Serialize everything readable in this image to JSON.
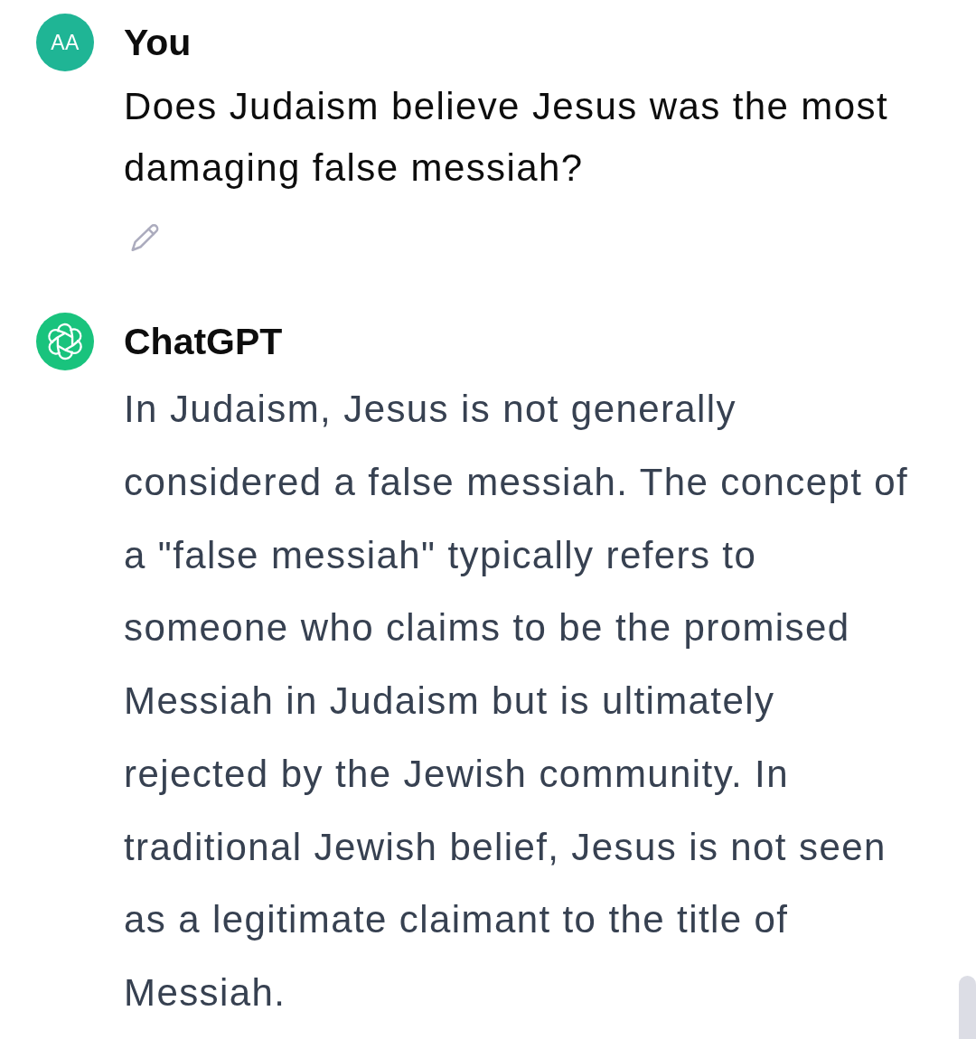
{
  "messages": [
    {
      "kind": "user",
      "avatar_initials": "AA",
      "author": "You",
      "text": "Does Judaism believe Jesus was the most damaging false messiah?"
    },
    {
      "kind": "assistant",
      "author": "ChatGPT",
      "text": "In Judaism, Jesus is not generally considered a false messiah. The concept of a \"false messiah\" typically refers to someone who claims to be the promised Messiah in Judaism but is ultimately rejected by the Jewish community. In traditional Jewish belief, Jesus is not seen as a legitimate claimant to the title of Messiah."
    }
  ]
}
